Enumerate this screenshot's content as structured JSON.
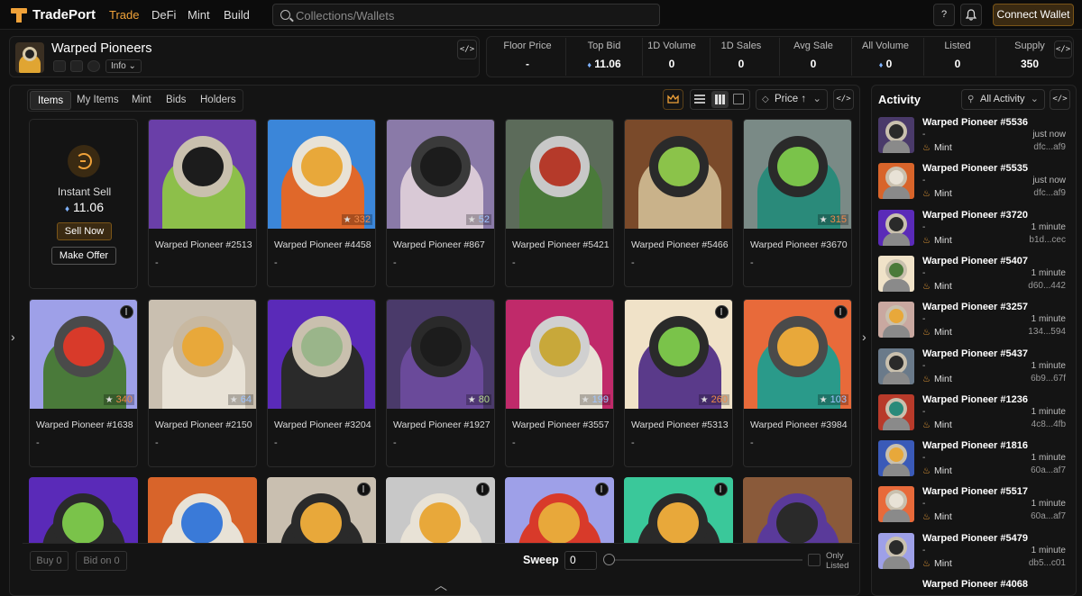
{
  "brand": {
    "name": "TradePort"
  },
  "nav": {
    "trade": "Trade",
    "defi": "DeFi",
    "mint": "Mint",
    "build": "Build"
  },
  "search": {
    "placeholder": "Collections/Wallets"
  },
  "header": {
    "help": "?",
    "connect_label": "Connect Wallet"
  },
  "collection": {
    "name": "Warped Pioneers",
    "info_label": "Info"
  },
  "stats": [
    {
      "label": "Floor Price",
      "value": "-"
    },
    {
      "label": "Top Bid",
      "value": "11.06"
    },
    {
      "label": "1D Volume",
      "value": "0"
    },
    {
      "label": "1D Sales",
      "value": "0"
    },
    {
      "label": "Avg Sale",
      "value": "0"
    },
    {
      "label": "All Volume",
      "value": "0"
    },
    {
      "label": "Listed",
      "value": "0"
    },
    {
      "label": "Supply",
      "value": "350"
    }
  ],
  "tabs": {
    "items": "Items",
    "my_items": "My Items",
    "mint": "Mint",
    "bids": "Bids",
    "holders": "Holders"
  },
  "sort": {
    "label": "Price ↑"
  },
  "instant_sell": {
    "title": "Instant Sell",
    "price": "11.06",
    "sell_now": "Sell Now",
    "make_offer": "Make Offer"
  },
  "cards": [
    {
      "name": "Warped Pioneer #2513",
      "price": "-",
      "rank": ""
    },
    {
      "name": "Warped Pioneer #4458",
      "price": "-",
      "rank": "332"
    },
    {
      "name": "Warped Pioneer #867",
      "price": "-",
      "rank": "52"
    },
    {
      "name": "Warped Pioneer #5421",
      "price": "-",
      "rank": ""
    },
    {
      "name": "Warped Pioneer #5466",
      "price": "-",
      "rank": ""
    },
    {
      "name": "Warped Pioneer #3670",
      "price": "-",
      "rank": "315"
    },
    {
      "name": "Warped Pioneer #1638",
      "price": "-",
      "rank": "340"
    },
    {
      "name": "Warped Pioneer #2150",
      "price": "-",
      "rank": "64"
    },
    {
      "name": "Warped Pioneer #3204",
      "price": "-",
      "rank": ""
    },
    {
      "name": "Warped Pioneer #1927",
      "price": "-",
      "rank": "80"
    },
    {
      "name": "Warped Pioneer #3557",
      "price": "-",
      "rank": "199"
    },
    {
      "name": "Warped Pioneer #5313",
      "price": "-",
      "rank": "260"
    },
    {
      "name": "Warped Pioneer #3984",
      "price": "-",
      "rank": "103"
    }
  ],
  "bottom": {
    "buy": "Buy 0",
    "bid": "Bid on 0",
    "sweep": "Sweep",
    "sweep_value": "0",
    "only_listed_1": "Only",
    "only_listed_2": "Listed"
  },
  "activity": {
    "title": "Activity",
    "filter": "All Activity",
    "rows": [
      {
        "name": "Warped Pioneer #5536",
        "price": "-",
        "type": "Mint",
        "time": "just now",
        "hash": "dfc...af9"
      },
      {
        "name": "Warped Pioneer #5535",
        "price": "-",
        "type": "Mint",
        "time": "just now",
        "hash": "dfc...af9"
      },
      {
        "name": "Warped Pioneer #3720",
        "price": "-",
        "type": "Mint",
        "time": "1 minute",
        "hash": "b1d...cec"
      },
      {
        "name": "Warped Pioneer #5407",
        "price": "-",
        "type": "Mint",
        "time": "1 minute",
        "hash": "d60...442"
      },
      {
        "name": "Warped Pioneer #3257",
        "price": "-",
        "type": "Mint",
        "time": "1 minute",
        "hash": "134...594"
      },
      {
        "name": "Warped Pioneer #5437",
        "price": "-",
        "type": "Mint",
        "time": "1 minute",
        "hash": "6b9...67f"
      },
      {
        "name": "Warped Pioneer #1236",
        "price": "-",
        "type": "Mint",
        "time": "1 minute",
        "hash": "4c8...4fb"
      },
      {
        "name": "Warped Pioneer #1816",
        "price": "-",
        "type": "Mint",
        "time": "1 minute",
        "hash": "60a...af7"
      },
      {
        "name": "Warped Pioneer #5517",
        "price": "-",
        "type": "Mint",
        "time": "1 minute",
        "hash": "60a...af7"
      },
      {
        "name": "Warped Pioneer #5479",
        "price": "-",
        "type": "Mint",
        "time": "1 minute",
        "hash": "db5...c01"
      },
      {
        "name": "Warped Pioneer #4068",
        "price": "",
        "type": "",
        "time": "",
        "hash": ""
      }
    ]
  },
  "colors": {
    "accent": "#f0a239",
    "background": "#111111"
  },
  "icons": [
    "search-icon",
    "bell-icon",
    "code-icon",
    "crown-icon",
    "list-view-icon",
    "grid-view-icon",
    "sui-coin-icon",
    "star-icon",
    "chevron-left-icon",
    "chevron-right-icon",
    "chevron-up-icon",
    "filter-icon"
  ]
}
